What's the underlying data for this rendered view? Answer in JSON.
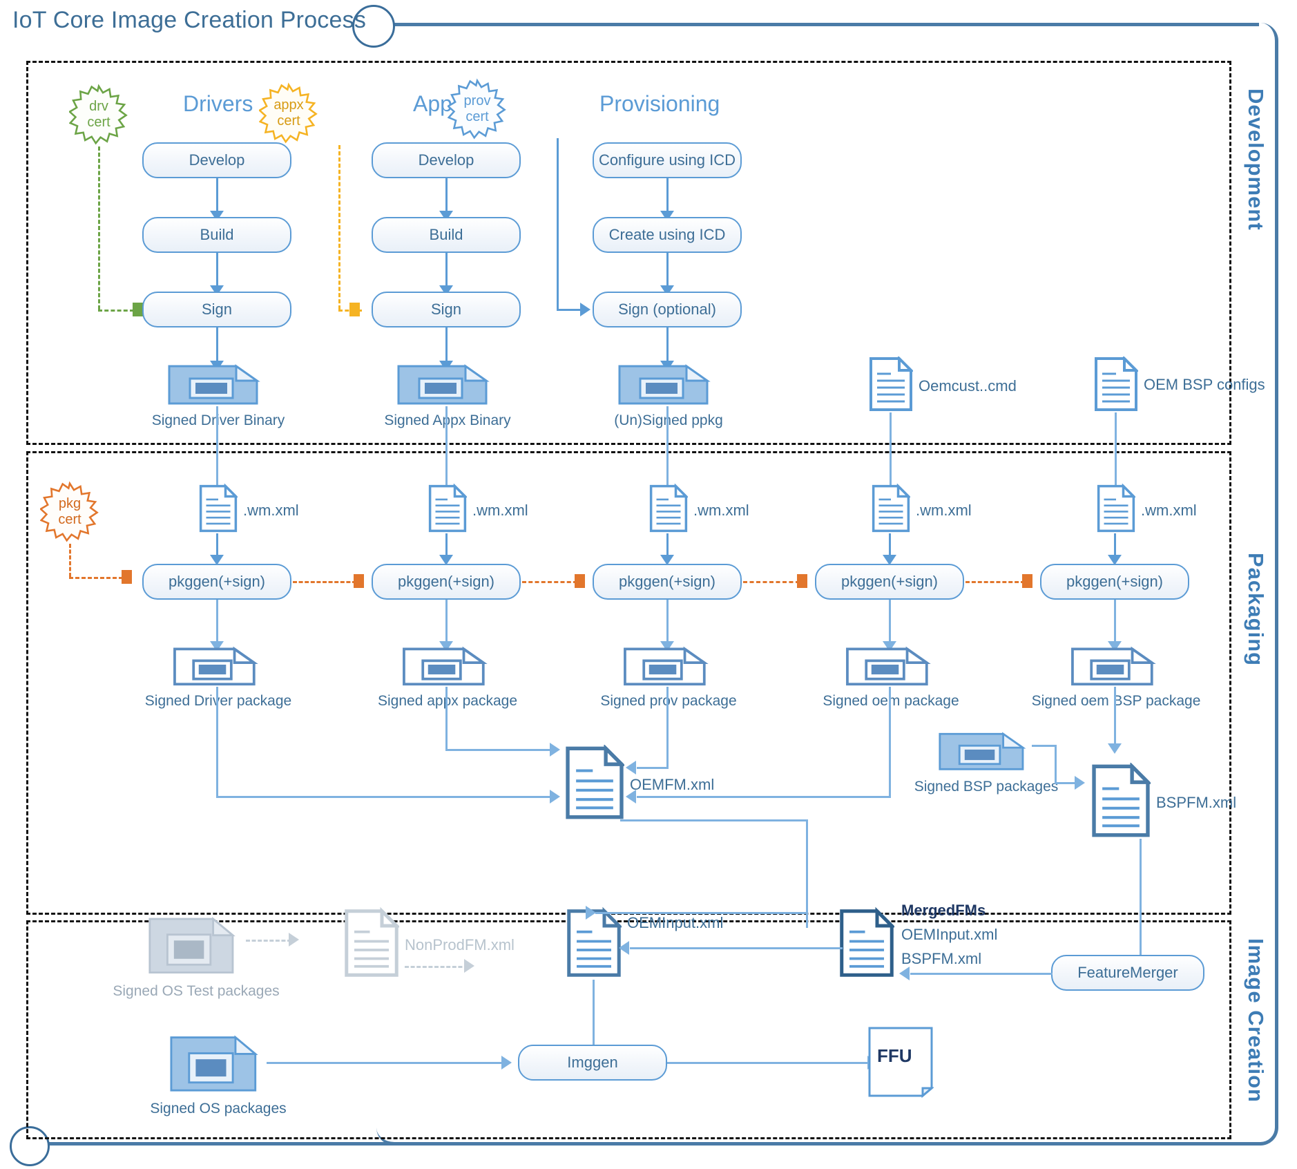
{
  "title": "IoT Core Image Creation Process",
  "sections": [
    {
      "id": "development",
      "label": "Development"
    },
    {
      "id": "packaging",
      "label": "Packaging"
    },
    {
      "id": "image_creation",
      "label": "Image Creation"
    }
  ],
  "development": {
    "columns": [
      {
        "title": "Drivers",
        "steps": [
          "Develop",
          "Build",
          "Sign"
        ]
      },
      {
        "title": "Apps",
        "steps": [
          "Develop",
          "Build",
          "Sign"
        ]
      },
      {
        "title": "Provisioning",
        "steps": [
          "Configure using ICD",
          "Create using ICD",
          "Sign (optional)"
        ]
      }
    ],
    "certs": [
      {
        "name": "drv cert",
        "line1": "drv",
        "line2": "cert",
        "color": "#6ca446"
      },
      {
        "name": "appx cert",
        "line1": "appx",
        "line2": "cert",
        "color": "#f5b323"
      },
      {
        "name": "prov cert",
        "line1": "prov",
        "line2": "cert",
        "color": "#5b9bd5"
      }
    ],
    "outputs": [
      "Signed Driver Binary",
      "Signed Appx Binary",
      "(Un)Signed ppkg"
    ],
    "documents": [
      "Oemcust..cmd",
      "OEM BSP configs"
    ]
  },
  "packaging": {
    "cert": {
      "name": "pkg cert",
      "line1": "pkg",
      "line2": "cert",
      "color": "#e2762c"
    },
    "wm_label": ".wm.xml",
    "wm_labels": [
      ".wm.xml",
      ".wm.xml",
      ".wm.xml",
      ".wm.xml",
      ".wm.xml"
    ],
    "pkggen_label": "pkggen(+sign)",
    "pkggen_labels": [
      "pkggen(+sign)",
      "pkggen(+sign)",
      "pkggen(+sign)",
      "pkggen(+sign)",
      "pkggen(+sign)"
    ],
    "packages": [
      "Signed Driver package",
      "Signed appx package",
      "Signed prov package",
      "Signed oem package",
      "Signed oem BSP package"
    ],
    "oemfm": "OEMFM.xml",
    "bspfm": "BSPFM.xml",
    "bsp_packages": "Signed BSP packages"
  },
  "image_creation": {
    "os_test_packages": "Signed OS Test packages",
    "nonprodfm": "NonProdFM.xml",
    "oeminput": "OEMInput.xml",
    "mergedfms_title": "MergedFMs",
    "mergedfms_lines": [
      "OEMInput.xml",
      "BSPFM.xml"
    ],
    "feature_merger": "FeatureMerger",
    "os_packages": "Signed OS packages",
    "imggen": "Imggen",
    "ffu": "FFU"
  },
  "colors": {
    "accent_blue": "#5b9bd5",
    "text_blue": "#3d6e96",
    "section_label_blue": "#3d7cb5",
    "frame_blue": "#4a7ba7",
    "green": "#6ca446",
    "yellow": "#f5b323",
    "orange": "#e2762c",
    "grey": "#c5cfd8"
  }
}
